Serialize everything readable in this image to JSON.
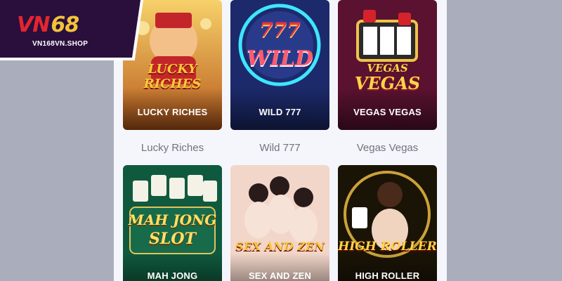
{
  "brand": {
    "mark_left": "VN",
    "mark_right": "68",
    "site": "VN168VN.SHOP"
  },
  "colors": {
    "background": "#a9adbc",
    "panel": "#f5f6fb",
    "caption": "#6f7480",
    "accent_red": "#e3262f",
    "accent_gold": "#f3c338"
  },
  "games": [
    {
      "name": "Lucky Riches",
      "banner": "LUCKY RICHES",
      "art_text": "LUCKY RICHES"
    },
    {
      "name": "Wild 777",
      "banner": "WILD 777",
      "art_text_top": "777",
      "art_text_bottom": "WILD"
    },
    {
      "name": "Vegas Vegas",
      "banner": "VEGAS VEGAS",
      "art_text_top": "VEGAS",
      "art_text_bottom": "VEGAS"
    },
    {
      "name": "Mah Jong",
      "banner": "MAH JONG",
      "art_text_top": "MAH JONG",
      "art_text_bottom": "SLOT"
    },
    {
      "name": "Sex and Zen",
      "banner": "SEX AND ZEN",
      "art_text": "SEX AND ZEN"
    },
    {
      "name": "High Roller",
      "banner": "HIGH ROLLER",
      "art_text": "HIGH ROLLER"
    }
  ]
}
